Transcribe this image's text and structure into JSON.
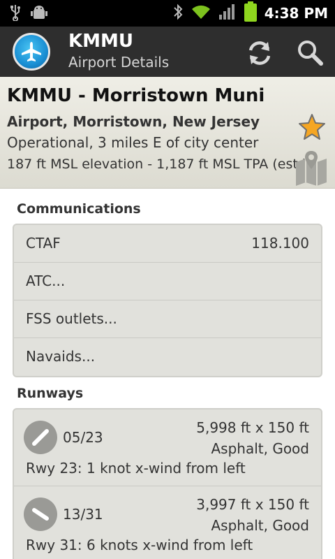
{
  "status_bar": {
    "time": "4:38 PM",
    "left_icons": [
      "usb-icon",
      "android-debug-icon"
    ],
    "right_icons": [
      "bluetooth-icon",
      "wifi-icon",
      "signal-icon",
      "battery-icon"
    ]
  },
  "action_bar": {
    "title": "KMMU",
    "subtitle": "Airport Details",
    "actions": [
      "refresh-icon",
      "search-icon"
    ]
  },
  "airport": {
    "name": "KMMU - Morristown Muni",
    "location": "Airport, Morristown, New Jersey",
    "status": "Operational, 3 miles E of city center",
    "elevation": "187 ft MSL elevation - 1,187 ft MSL TPA  (est.)"
  },
  "communications": {
    "title": "Communications",
    "rows": [
      {
        "label": "CTAF",
        "value": "118.100"
      },
      {
        "label": "ATC...",
        "value": ""
      },
      {
        "label": "FSS outlets...",
        "value": ""
      },
      {
        "label": "Navaids...",
        "value": ""
      }
    ]
  },
  "runways": {
    "title": "Runways",
    "items": [
      {
        "id": "05/23",
        "dimensions": "5,998 ft x 150 ft",
        "surface": "Asphalt, Good",
        "wind": "Rwy 23: 1 knot x-wind from left"
      },
      {
        "id": "13/31",
        "dimensions": "3,997 ft x 150 ft",
        "surface": "Asphalt, Good",
        "wind": "Rwy 31: 6 knots x-wind from left"
      }
    ]
  },
  "colors": {
    "action_bar": "#2e2e2e",
    "header_bg": "#e6e5dc",
    "card_bg": "#e1e1dc",
    "star": "#f5a623"
  }
}
